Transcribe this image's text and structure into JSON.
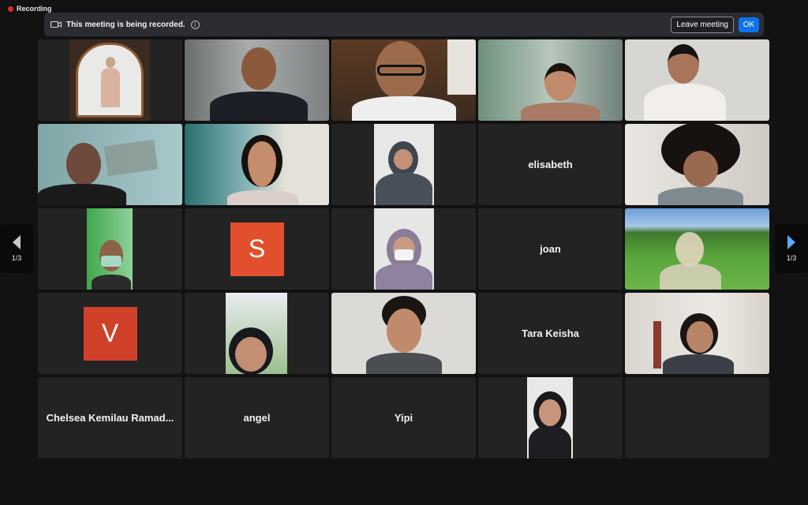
{
  "recording": {
    "label": "Recording"
  },
  "banner": {
    "message": "This meeting is being recorded.",
    "leave_label": "Leave meeting",
    "ok_label": "OK",
    "info_glyph": "i"
  },
  "colors": {
    "active_border": "#23d959",
    "accent": "#0e72ed",
    "avatar": "#e24f2c",
    "recording": "#e02828"
  },
  "participants": [
    {
      "type": "video",
      "icon": "person-in-doorway-video"
    },
    {
      "type": "video",
      "icon": "smiling-man-video",
      "active": true
    },
    {
      "type": "video",
      "icon": "man-with-glasses-video"
    },
    {
      "type": "video",
      "icon": "woman-with-glasses-video"
    },
    {
      "type": "video",
      "icon": "young-man-video"
    },
    {
      "type": "video",
      "icon": "man-video"
    },
    {
      "type": "video",
      "icon": "woman-video"
    },
    {
      "type": "video",
      "icon": "woman-hijab-video"
    },
    {
      "type": "name",
      "name": "elisabeth"
    },
    {
      "type": "video",
      "icon": "curly-hair-man-video"
    },
    {
      "type": "video",
      "icon": "masked-man-video"
    },
    {
      "type": "avatar",
      "initial": "S"
    },
    {
      "type": "video",
      "icon": "masked-woman-hijab-video"
    },
    {
      "type": "name",
      "name": "joan"
    },
    {
      "type": "video",
      "icon": "rice-field-background-video"
    },
    {
      "type": "avatar",
      "initial": "V"
    },
    {
      "type": "video",
      "icon": "girl-outdoor-video"
    },
    {
      "type": "video",
      "icon": "young-man-video"
    },
    {
      "type": "name",
      "name": "Tara Keisha"
    },
    {
      "type": "video",
      "icon": "woman-headset-video"
    },
    {
      "type": "name",
      "name": "Chelsea Kemilau Ramad..."
    },
    {
      "type": "name",
      "name": "angel"
    },
    {
      "type": "name",
      "name": "Yipi"
    },
    {
      "type": "video",
      "icon": "woman-hijab-video"
    },
    {
      "type": "empty"
    }
  ],
  "pagination": {
    "left_label": "1/3",
    "right_label": "1/3"
  }
}
